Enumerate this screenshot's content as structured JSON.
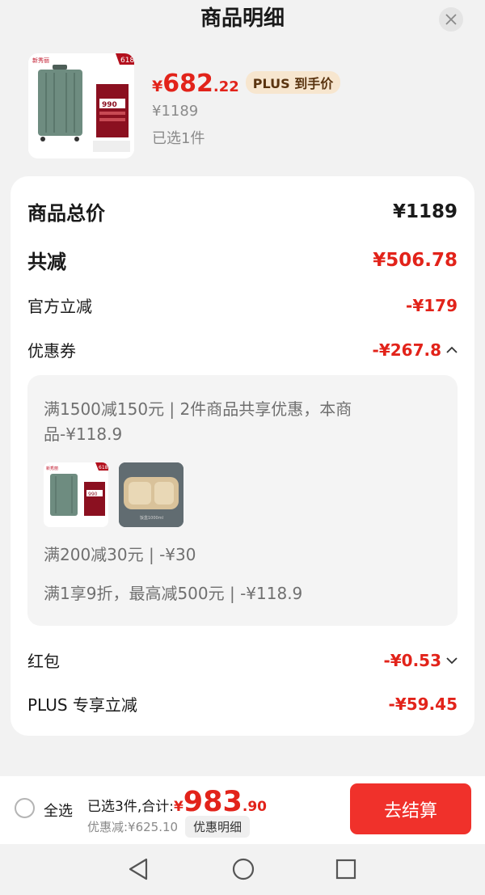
{
  "header": {
    "title": "商品明细"
  },
  "product": {
    "price_currency": "¥",
    "price_int": "682",
    "price_dec": ".22",
    "plus_tag": "PLUS 到手价",
    "original_price": "¥1189",
    "selected": "已选1件",
    "image_badge": "618",
    "image_brand": "新秀丽",
    "image_price": "990"
  },
  "breakdown": {
    "total_label": "商品总价",
    "total_value": "¥1189",
    "reduce_label": "共减",
    "reduce_value": "¥506.78",
    "official_label": "官方立减",
    "official_value": "-¥179",
    "coupon_label": "优惠券",
    "coupon_value": "-¥267.8",
    "coupon_details": {
      "line1": "满1500减150元 | 2件商品共享优惠，本商",
      "line2": "品-¥118.9",
      "line3": "满200减30元 | -¥30",
      "line4": "满1享9折，最高减500元 | -¥118.9",
      "thumb2_caption": "饭盒1000ml"
    },
    "redpacket_label": "红包",
    "redpacket_value": "-¥0.53",
    "plus_label": "PLUS 专享立减",
    "plus_value": "-¥59.45"
  },
  "bottom_bar": {
    "select_all": "全选",
    "total_label": "已选3件,合计:",
    "total_currency": "¥",
    "total_int": "983",
    "total_dec": ".90",
    "discount_text": "优惠减:¥625.10",
    "detail_button": "优惠明细",
    "checkout_button": "去结算"
  },
  "colors": {
    "accent": "#e2231a",
    "checkout": "#f0312b",
    "plus_tag_bg": "#f7e6cf"
  }
}
